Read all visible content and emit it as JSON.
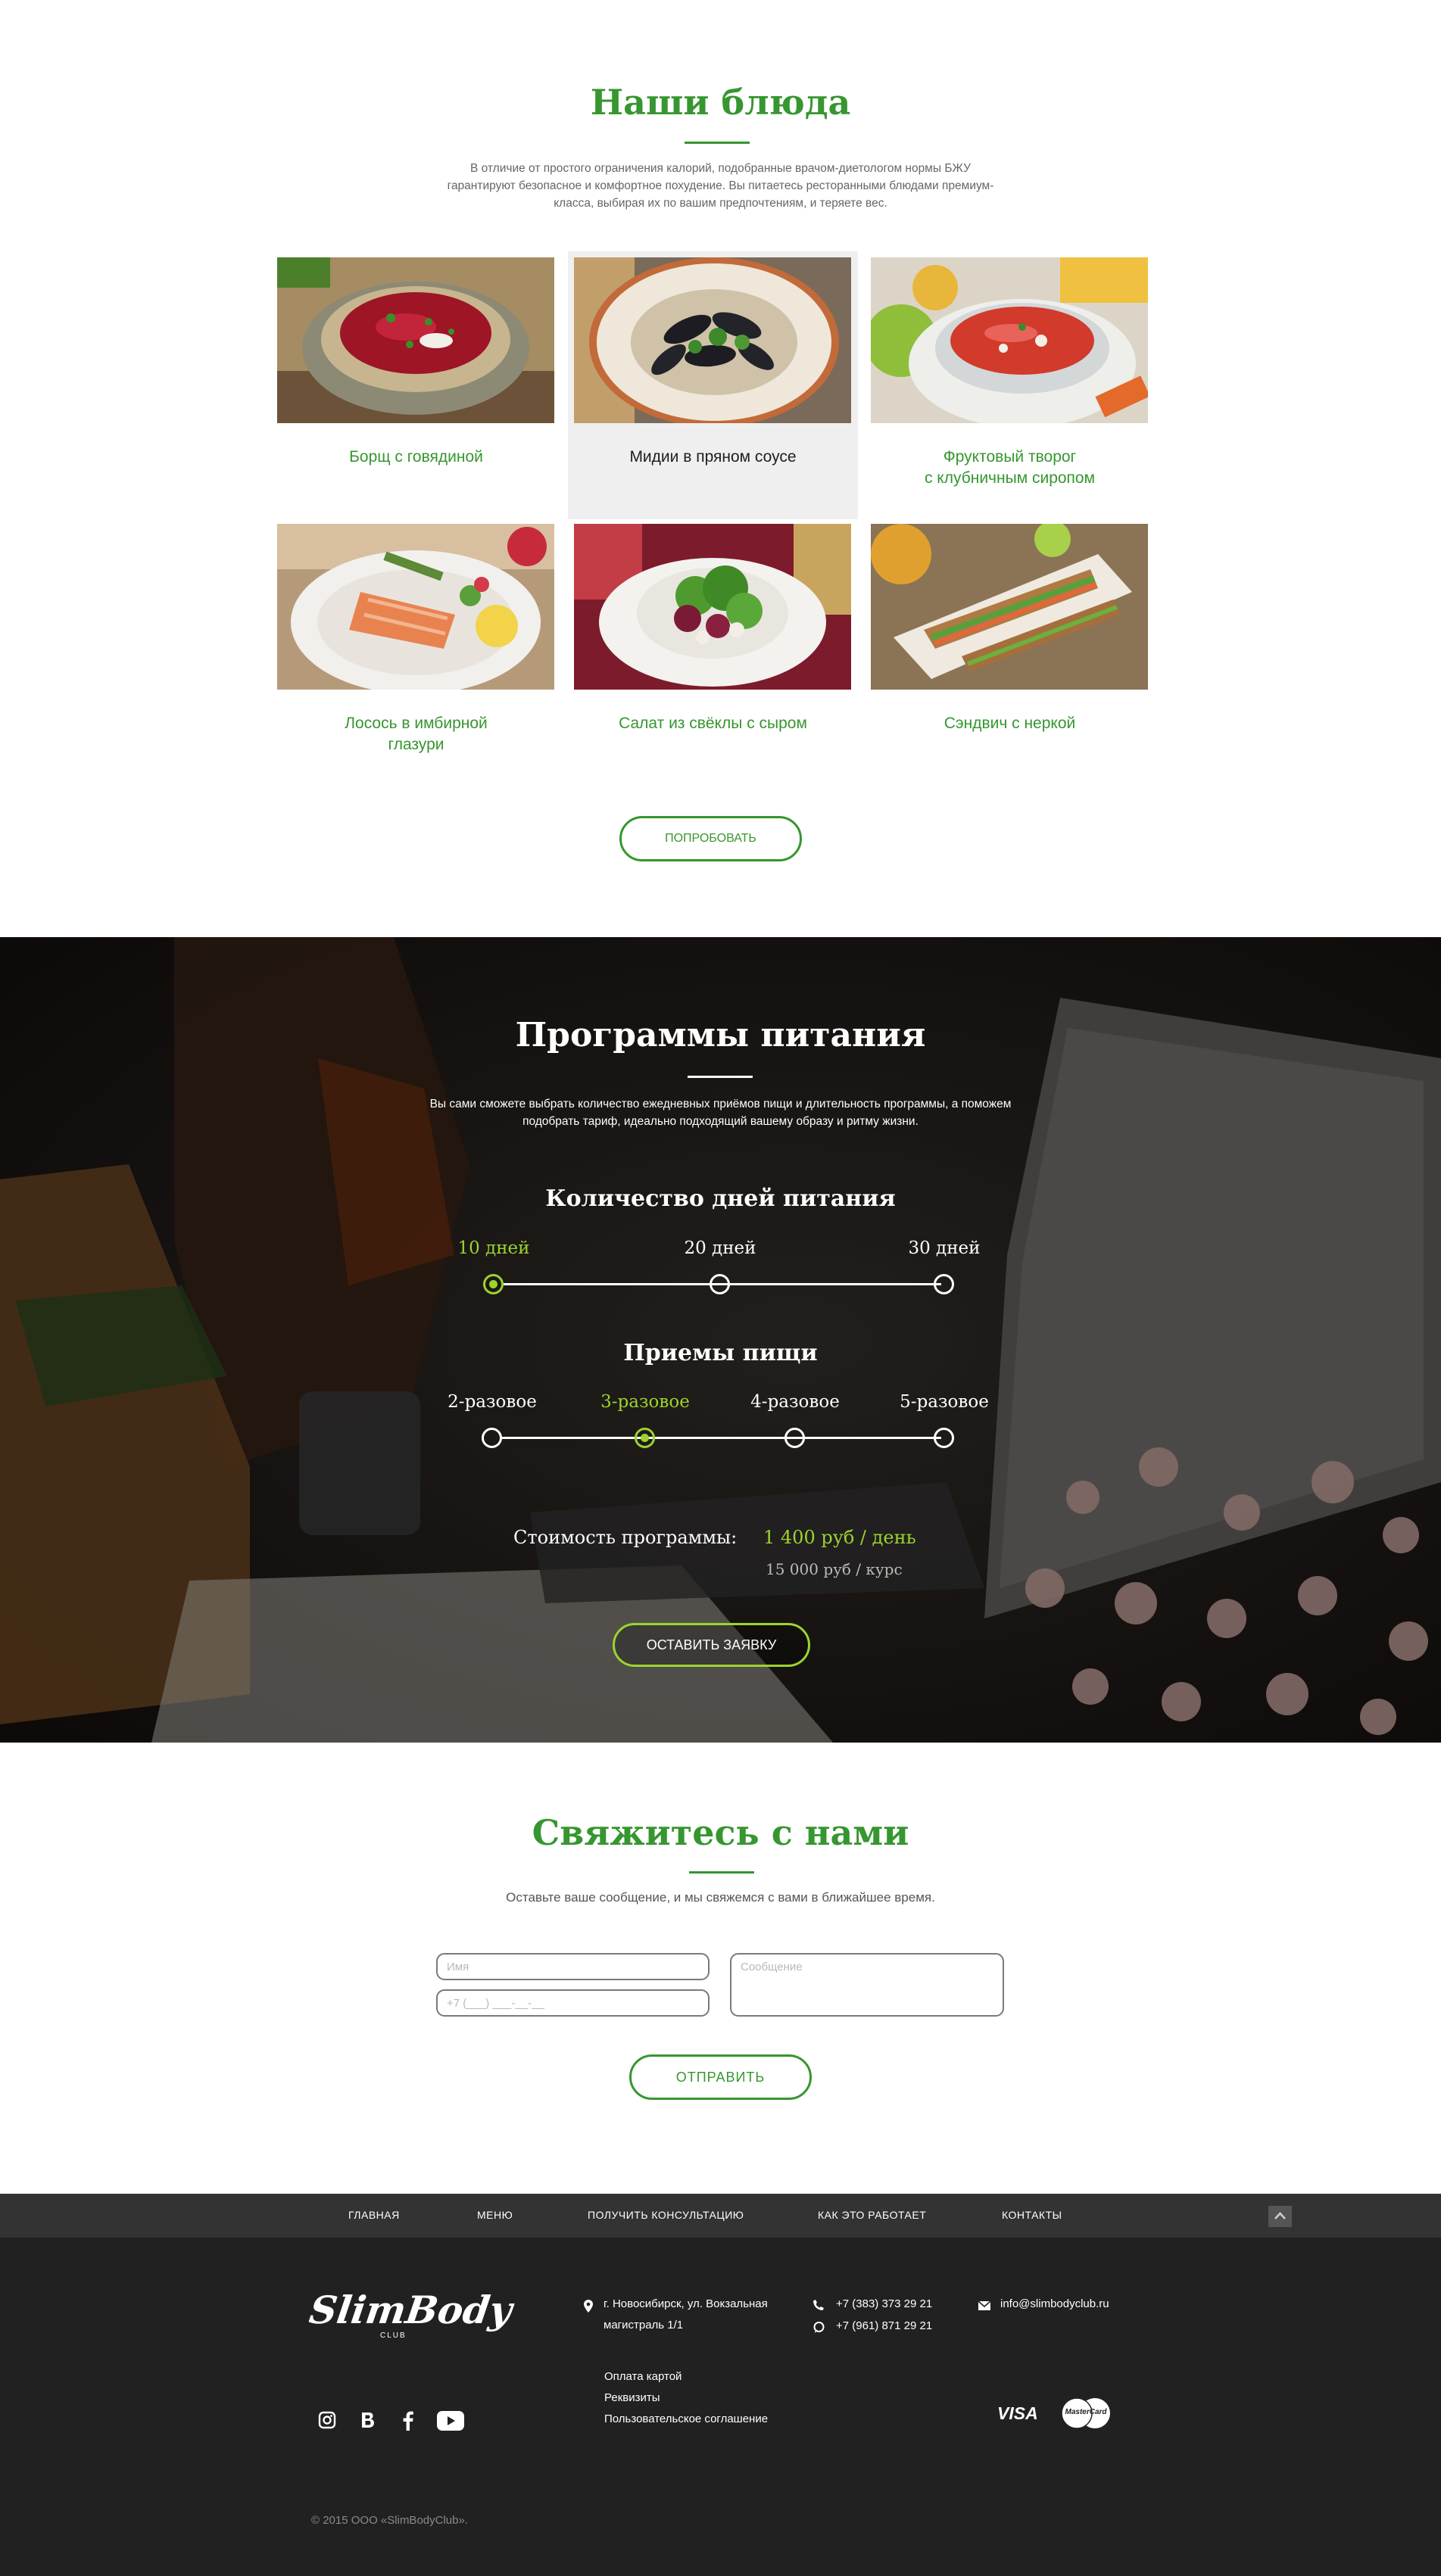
{
  "dishes": {
    "title": "Наши блюда",
    "lead": "В отличие от простого ограничения калорий, подобранные врачом-диетологом нормы БЖУ гарантируют безопасное и комфортное похудение. Вы питаетесь ресторанными блюдами премиум-класса, выбирая их по вашим предпочтениям, и теряете вес.",
    "items": [
      {
        "name": "Борщ с говядиной"
      },
      {
        "name": "Мидии в пряном соусе"
      },
      {
        "name": "Фруктовый творог\nс клубничным сиропом"
      },
      {
        "name": "Лосось в имбирной\nглазури"
      },
      {
        "name": "Салат из свёклы с сыром"
      },
      {
        "name": "Сэндвич с неркой"
      }
    ],
    "try_button": "ПОПРОБОВАТЬ"
  },
  "programs": {
    "title": "Программы питания",
    "lead": "Вы сами сможете выбрать количество ежедневных приёмов пищи и длительность программы, а поможем подобрать тариф, идеально подходящий вашему образу и ритму жизни.",
    "days_title": "Количество дней питания",
    "days": [
      "10 дней",
      "20 дней",
      "30 дней"
    ],
    "days_selected": 0,
    "meals_title": "Приемы пищи",
    "meals": [
      "2-разовое",
      "3-разовое",
      "4-разовое",
      "5-разовое"
    ],
    "meals_selected": 1,
    "cost_label": "Стоимость программы:",
    "cost_value": "1 400 руб / день",
    "cost_course": "15 000 руб / курс",
    "apply_button": "ОСТАВИТЬ ЗАЯВКУ"
  },
  "contact": {
    "title": "Свяжитесь с нами",
    "lead": "Оставьте ваше сообщение, и мы свяжемся с вами в ближайшее время.",
    "name_placeholder": "Имя",
    "phone_placeholder": "+7 (___) ___-__-__",
    "message_placeholder": "Сообщение",
    "send_button": "ОТПРАВИТЬ"
  },
  "footer": {
    "nav": [
      "ГЛАВНАЯ",
      "МЕНЮ",
      "ПОЛУЧИТЬ КОНСУЛЬТАЦИЮ",
      "КАК ЭТО РАБОТАЕТ",
      "КОНТАКТЫ"
    ],
    "logo_text": "SlimBody",
    "logo_sub": "CLUB",
    "address": "г. Новосибирск, ул. Вокзальная\nмагистраль 1/1",
    "phone1": "+7 (383) 373 29 21",
    "phone2": "+7 (961) 871 29 21",
    "email": "info@slimbodyclub.ru",
    "links": [
      "Оплата картой",
      "Реквизиты",
      "Пользовательское соглашение"
    ],
    "visa": "VISA",
    "mastercard": "MasterCard",
    "copyright": "© 2015 ООО «SlimBodyClub»."
  },
  "colors": {
    "brand_green": "#36962f",
    "accent_lime": "#9bd42d",
    "footer_bg": "#212121",
    "footer_nav_bg": "#333333"
  }
}
